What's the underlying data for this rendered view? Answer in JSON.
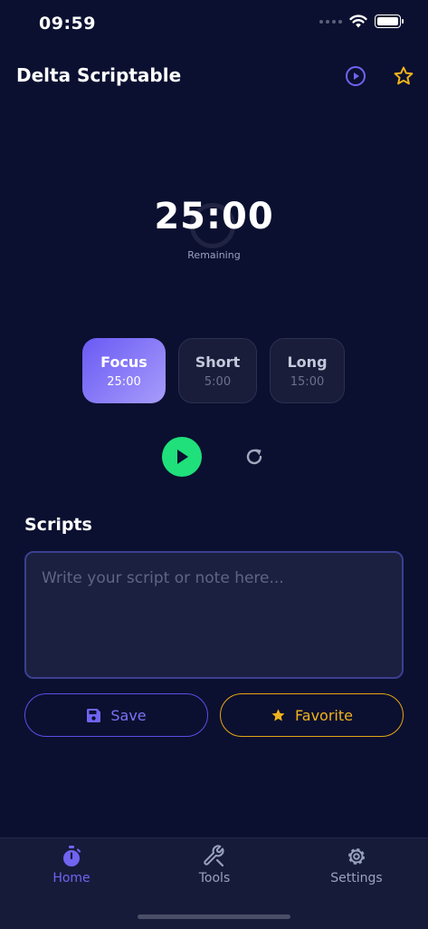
{
  "status_bar": {
    "time": "09:59"
  },
  "header": {
    "title": "Delta Scriptable",
    "play_icon": "play-circle-icon",
    "star_icon": "star-outline-icon"
  },
  "timer": {
    "value": "25:00",
    "label": "Remaining",
    "progress": 0
  },
  "modes": [
    {
      "label": "Focus",
      "time": "25:00",
      "selected": true
    },
    {
      "label": "Short",
      "time": "5:00",
      "selected": false
    },
    {
      "label": "Long",
      "time": "15:00",
      "selected": false
    }
  ],
  "controls": {
    "play_icon": "play-icon",
    "reset_icon": "refresh-icon",
    "play_color": "#1fe07a"
  },
  "scripts": {
    "title": "Scripts",
    "placeholder": "Write your script or note here...",
    "save_label": "Save",
    "favorite_label": "Favorite"
  },
  "tabs": [
    {
      "label": "Home",
      "icon": "stopwatch-icon",
      "active": true
    },
    {
      "label": "Tools",
      "icon": "wrench-icon",
      "active": false
    },
    {
      "label": "Settings",
      "icon": "gear-icon",
      "active": false
    }
  ],
  "colors": {
    "background": "#0b1030",
    "accent": "#6a5af4",
    "favorite": "#f0b21c",
    "play": "#1fe07a"
  }
}
